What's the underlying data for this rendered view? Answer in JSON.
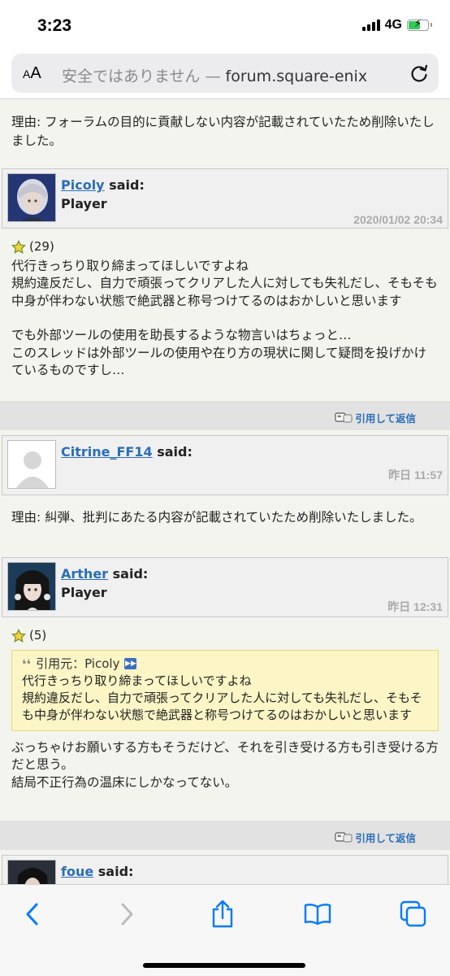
{
  "status": {
    "time": "3:23",
    "network": "4G"
  },
  "browser": {
    "text_size_small": "A",
    "text_size_large": "A",
    "url_prefix": "安全ではありません — ",
    "url_domain": "forum.square-enix"
  },
  "notice1": "理由: フォーラムの目的に貢献しない内容が記載されていたため削除いたしました。",
  "post1": {
    "user": "Picoly",
    "said": " said:",
    "role": "Player",
    "date": "2020/01/02 20:34",
    "likes": "(29)",
    "lines": [
      "代行きっちり取り締まってほしいですよね",
      "規約違反だし、自力で頑張ってクリアした人に対しても失礼だし、そもそも中身が伴わない状態で絶武器と称号つけてるのはおかしいと思います",
      "",
      "でも外部ツールの使用を助長するような物言いはちょっと…",
      "このスレッドは外部ツールの使用や在り方の現状に関して疑問を投げかけているものですし…"
    ]
  },
  "reply_label": "引用して返信",
  "post2": {
    "user": "Citrine_FF14",
    "said": " said:",
    "date": "昨日 11:57"
  },
  "notice2": "理由: 糾弾、批判にあたる内容が記載されていたため削除いたしました。",
  "post3": {
    "user": "Arther",
    "said": " said:",
    "role": "Player",
    "date": "昨日 12:31",
    "likes": "(5)",
    "quote_head": "引用元：Picoly",
    "quote_lines": [
      "代行きっちり取り締まってほしいですよね",
      "規約違反だし、自力で頑張ってクリアした人に対しても失礼だし、そもそも中身が伴わない状態で絶武器と称号つけてるのはおかしいと思います"
    ],
    "lines": [
      "ぶっちゃけお願いする方もそうだけど、それを引き受ける方も引き受ける方だと思う。",
      "結局不正行為の温床にしかなってない。"
    ]
  },
  "post4": {
    "user": "foue",
    "said": " said:"
  },
  "colors": {
    "link": "#2a6eb8",
    "accent": "#007aff",
    "quote_bg": "#fcf5c6",
    "battery": "#34c759"
  }
}
